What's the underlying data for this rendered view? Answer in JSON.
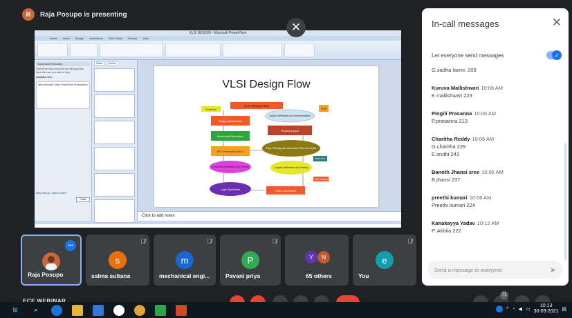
{
  "presenter": {
    "initial": "R",
    "text": "Raja Posupo is presenting"
  },
  "stage": {
    "app_title": "VLSI DESIGN - Microsoft PowerPoint",
    "ribbon_tabs": [
      "Home",
      "Insert",
      "Design",
      "Animations",
      "Slide Show",
      "Review",
      "View"
    ],
    "pane_title": "Document Recovery",
    "pane_text": "PowerPoint has recovered the following files. Save the ones you wish to keep.",
    "pane_subtitle": "Available files",
    "pane_file": "New Microsoft Office PowerPoint Presentation",
    "pane_footer": "Which file do I want to save?",
    "pane_close": "Close",
    "slides_tabs": [
      "Slides",
      "Outline"
    ],
    "slide_title": "VLSI Design Flow",
    "notes_placeholder": "Click to add notes",
    "flow": {
      "top": "VLSI Design Flow",
      "front": "Front End",
      "back": "Back End",
      "spec": "Design Specification",
      "behav": "Behavioral Description",
      "rtl": "RTL Description (HDL)",
      "func": "Functional Verification And Testing",
      "logic": "Logic Synthesis",
      "gate": "Gate-Level Netlist",
      "lv": "Logical Verification and Testing",
      "floor": "Floor Planning and Automatic Place and Route",
      "phys": "Physical Layout",
      "layout_ver": "Layout Verification and Implementation",
      "chip": "CHIP",
      "timing": "Time Analysis"
    }
  },
  "close_share_icon": "close-icon",
  "chat": {
    "title": "In-call messages",
    "toggle_label": "Let everyone send messages",
    "messages": [
      {
        "sender": "",
        "time": "",
        "lines": [
          "G.sadha laxmi. 209"
        ]
      },
      {
        "sender": "Kuruva Mallishwari",
        "time": "10:06 AM",
        "lines": [
          "K mallishwari 223"
        ]
      },
      {
        "sender": "Pingili Prasanna",
        "time": "10:06 AM",
        "lines": [
          "P.prasanna 213"
        ]
      },
      {
        "sender": "Charitha Reddy",
        "time": "10:06 AM",
        "lines": [
          "G.charitha 229",
          "E.sruthi 243"
        ]
      },
      {
        "sender": "Banoth Jhansi sree",
        "time": "10:06 AM",
        "lines": [
          "B.jhansi 237"
        ]
      },
      {
        "sender": "preethi kumari",
        "time": "10:06 AM",
        "lines": [
          "Preethi kumari 224"
        ]
      },
      {
        "sender": "Kanakayya Yadav",
        "time": "10:12 AM",
        "lines": [
          "P. Akhila 222"
        ]
      }
    ],
    "input_placeholder": "Send a message to everyone"
  },
  "participants": [
    {
      "name": "Raja Posupo",
      "initial": "",
      "color": "#c9663b",
      "more": "•••"
    },
    {
      "name": "salma sultana",
      "initial": "s",
      "color": "#e8710a"
    },
    {
      "name": "mechanical engi...",
      "initial": "m",
      "color": "#1967d2"
    },
    {
      "name": "Pavani priya",
      "initial": "P",
      "color": "#34a853"
    },
    {
      "name": "65 others",
      "initials": [
        "Y",
        "N"
      ],
      "colors": [
        "#5e35b1",
        "#c05a2a"
      ]
    },
    {
      "name": "You",
      "initial": "e",
      "color": "#129eaf"
    }
  ],
  "meeting_name": "ECE WEBINAR",
  "taskbar": {
    "badge": "71",
    "time": "10:13",
    "date": "30-09-2021",
    "accent": "#1a73e8"
  }
}
